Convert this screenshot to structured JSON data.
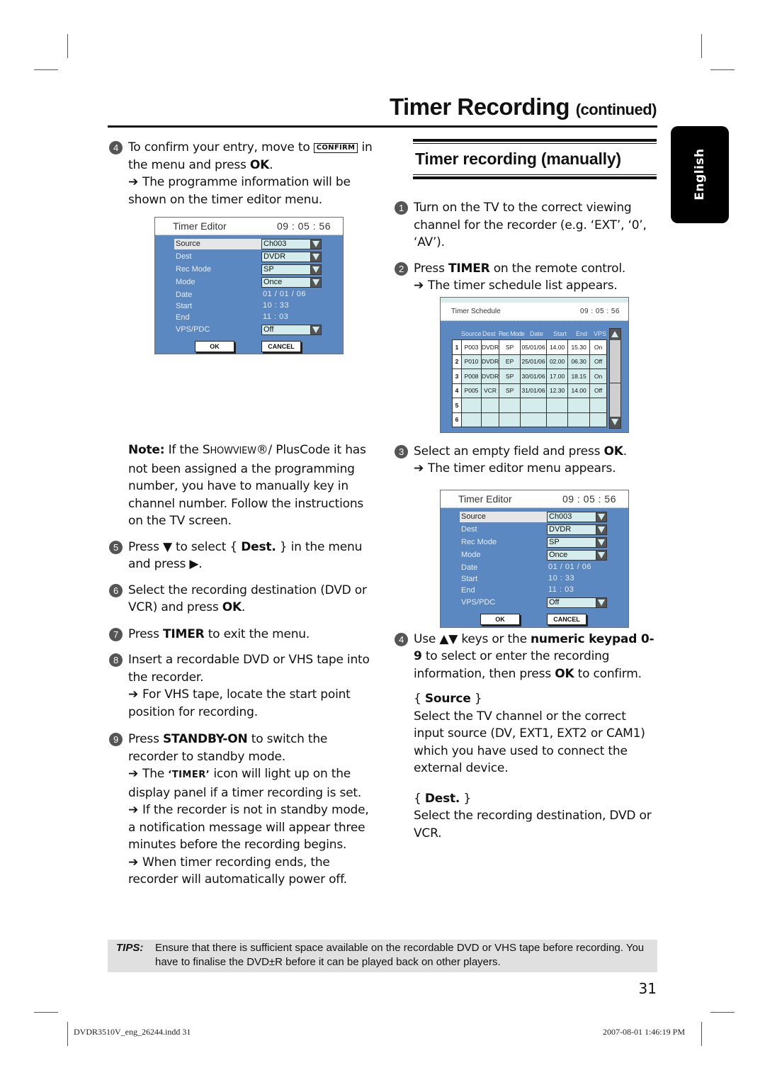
{
  "header": {
    "title": "Timer Recording",
    "subtitle": "(continued)"
  },
  "language_tab": "English",
  "left_column": {
    "step4": {
      "num": "4",
      "text_before": "To confirm your entry, move to ",
      "key": "CONFIRM",
      "text_mid": " in the menu and press ",
      "bold": "OK",
      "text_end": ".",
      "result": "The programme information will be shown on the timer editor menu."
    },
    "note": {
      "label": "Note:",
      "text_a": " If the S",
      "showview": "HOWVIEW",
      "text_b": "®/ PlusCode it has not been assigned a the programming number, you have to manually key in channel number. Follow the instructions on the TV screen."
    },
    "step5": {
      "num": "5",
      "a": "Press ▼ to select { ",
      "bold": "Dest.",
      "b": " } in the menu and press ▶."
    },
    "step6": {
      "num": "6",
      "a": "Select the recording destination (DVD or VCR) and press ",
      "bold": "OK",
      "b": "."
    },
    "step7": {
      "num": "7",
      "a": "Press ",
      "bold": "TIMER",
      "b": " to exit the menu."
    },
    "step8": {
      "num": "8",
      "a": "Insert a recordable DVD or VHS tape into the recorder.",
      "result": "For VHS tape, locate the start point position for recording."
    },
    "step9": {
      "num": "9",
      "a": "Press ",
      "bold": "STANDBY-ON",
      "b": " to switch the recorder to standby mode.",
      "r1_a": "The ",
      "r1_key": "‘TIMER’",
      "r1_b": " icon will light up on the display panel if a timer recording is set.",
      "r2": "If the recorder is not in standby mode, a notification message will appear three minutes before the recording begins.",
      "r3": "When timer recording ends, the recorder will automatically power off."
    }
  },
  "timer_editor": {
    "title": "Timer Editor",
    "time": "09 : 05 : 56",
    "rows": [
      {
        "label": "Source",
        "value": "Ch003",
        "dropdown": true,
        "selected": true
      },
      {
        "label": "Dest",
        "value": "DVDR",
        "dropdown": true
      },
      {
        "label": "Rec Mode",
        "value": "SP",
        "dropdown": true
      },
      {
        "label": "Mode",
        "value": "Once",
        "dropdown": true
      },
      {
        "label": "Date",
        "value": "01 / 01 / 06",
        "dropdown": false
      },
      {
        "label": "Start",
        "value": "10 : 33",
        "dropdown": false
      },
      {
        "label": "End",
        "value": "11 : 03",
        "dropdown": false
      },
      {
        "label": "VPS/PDC",
        "value": "Off",
        "dropdown": true
      }
    ],
    "ok_label": "OK",
    "cancel_label": "CANCEL"
  },
  "right_column": {
    "section_title": "Timer recording (manually)",
    "step1": {
      "num": "1",
      "text": "Turn on the TV to the correct viewing channel for the recorder (e.g. ‘EXT’, ‘0’, ‘AV’)."
    },
    "step2": {
      "num": "2",
      "a": "Press ",
      "bold": "TIMER",
      "b": " on the remote control.",
      "result": "The timer schedule list appears."
    },
    "step3": {
      "num": "3",
      "a": "Select an empty field and press ",
      "bold": "OK",
      "b": ".",
      "result": "The timer editor menu appears."
    },
    "step4": {
      "num": "4",
      "a": "Use ▲▼ keys or the ",
      "bold1": "numeric keypad 0-9",
      "b": " to select or enter the recording information, then press ",
      "bold2": "OK",
      "c": " to confirm."
    },
    "source": {
      "open": "{ ",
      "label": "Source",
      "close": " }",
      "text": "Select the TV channel or the correct input source (DV, EXT1, EXT2 or CAM1) which you have used to connect the external device."
    },
    "dest": {
      "open": "{ ",
      "label": "Dest.",
      "close": " }",
      "text": "Select the recording destination, DVD or VCR."
    }
  },
  "timer_schedule": {
    "title": "Timer Schedule",
    "time": "09 : 05 : 56",
    "columns": [
      "Source",
      "Dest",
      "Rec Mode",
      "Date",
      "Start",
      "End",
      "VPS"
    ],
    "rows": [
      [
        "1",
        "P003",
        "DVDR",
        "SP",
        "05/01/06",
        "14.00",
        "15.30",
        "On"
      ],
      [
        "2",
        "P010",
        "DVDR",
        "EP",
        "25/01/06",
        "02.00",
        "06.30",
        "Off"
      ],
      [
        "3",
        "P008",
        "DVDR",
        "SP",
        "30/01/06",
        "17.00",
        "18.15",
        "On"
      ],
      [
        "4",
        "P005",
        "VCR",
        "SP",
        "31/01/06",
        "12.30",
        "14.00",
        "Off"
      ],
      [
        "5",
        "",
        "",
        "",
        "",
        "",
        "",
        ""
      ],
      [
        "6",
        "",
        "",
        "",
        "",
        "",
        "",
        ""
      ]
    ]
  },
  "tips": {
    "label": "TIPS:",
    "text": "Ensure that there is sufficient space available on the recordable DVD or VHS tape before recording. You have to finalise the DVD±R before it can be played back on other players."
  },
  "page_number": "31",
  "footer": {
    "file": "DVDR3510V_eng_26244.indd   31",
    "timestamp": "2007-08-01   1:46:19 PM"
  }
}
